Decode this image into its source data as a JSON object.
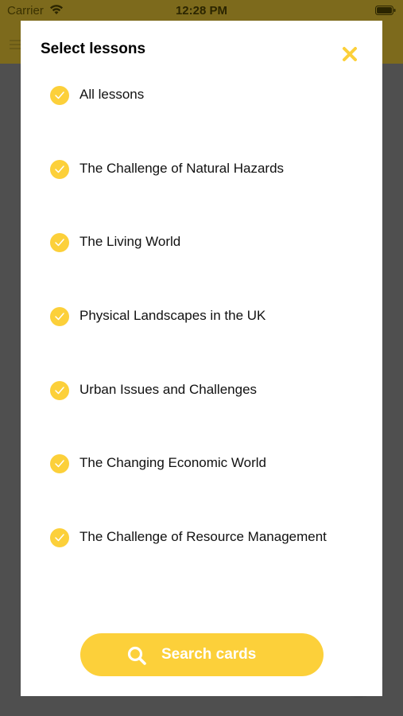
{
  "status_bar": {
    "carrier": "Carrier",
    "time": "12:28 PM"
  },
  "modal": {
    "title": "Select lessons",
    "close_icon": "close-x-icon",
    "lessons": [
      {
        "label": "All lessons",
        "checked": true
      },
      {
        "label": "The Challenge of Natural Hazards",
        "checked": true
      },
      {
        "label": "The Living World",
        "checked": true
      },
      {
        "label": "Physical Landscapes in the UK",
        "checked": true
      },
      {
        "label": "Urban Issues and Challenges",
        "checked": true
      },
      {
        "label": "The Changing Economic World",
        "checked": true
      },
      {
        "label": "The Challenge of Resource Management",
        "checked": true
      }
    ],
    "search_button": {
      "label": "Search cards",
      "icon": "search-icon"
    }
  },
  "colors": {
    "accent": "#fcd03a",
    "overlay": "#4f4f4f",
    "header_dimmed": "#7d6a1c"
  }
}
